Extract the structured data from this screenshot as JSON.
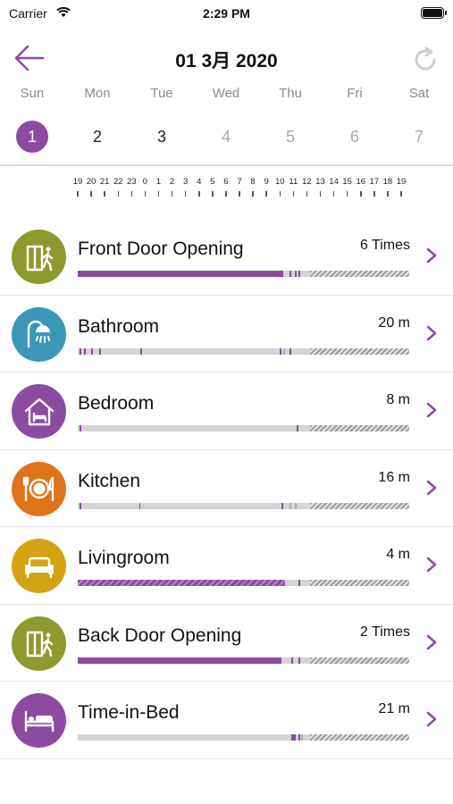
{
  "status_bar": {
    "carrier": "Carrier",
    "time": "2:29 PM"
  },
  "header": {
    "title": "01 3月 2020",
    "back_icon": "arrow-left-icon",
    "refresh_icon": "refresh-icon"
  },
  "colors": {
    "accent": "#8b4b9f",
    "olive": "#8e9a2f",
    "teal": "#3b97b5",
    "orange": "#e0731a",
    "mustard": "#d2a313",
    "purple": "#8b4b9f",
    "bar_bg": "#d4d4d4"
  },
  "weekdays": [
    "Sun",
    "Mon",
    "Tue",
    "Wed",
    "Thu",
    "Fri",
    "Sat"
  ],
  "days": [
    {
      "label": "1",
      "state": "selected"
    },
    {
      "label": "2",
      "state": "past"
    },
    {
      "label": "3",
      "state": "past"
    },
    {
      "label": "4",
      "state": "future"
    },
    {
      "label": "5",
      "state": "future"
    },
    {
      "label": "6",
      "state": "future"
    },
    {
      "label": "7",
      "state": "future"
    }
  ],
  "hour_labels": [
    "19",
    "20",
    "21",
    "22",
    "23",
    "0",
    "1",
    "2",
    "3",
    "4",
    "5",
    "6",
    "7",
    "8",
    "9",
    "10",
    "11",
    "12",
    "13",
    "14",
    "15",
    "16",
    "17",
    "18",
    "19"
  ],
  "rooms": [
    {
      "label": "Front Door Opening",
      "value": "6 Times",
      "icon": "door-walk-icon",
      "color": "#8e9a2f",
      "activity": [
        [
          0.0,
          0.62,
          "solid"
        ],
        [
          0.64,
          0.005,
          "solid"
        ],
        [
          0.655,
          0.004,
          "solid"
        ],
        [
          0.665,
          0.004,
          "solid"
        ]
      ],
      "now": 0.7
    },
    {
      "label": "Bathroom",
      "value": "20 m",
      "icon": "shower-icon",
      "color": "#3b97b5",
      "activity": [
        [
          0.005,
          0.004,
          "solid"
        ],
        [
          0.02,
          0.004,
          "solid"
        ],
        [
          0.04,
          0.004,
          "solid"
        ],
        [
          0.065,
          0.004,
          "solid"
        ],
        [
          0.19,
          0.004,
          "solid"
        ],
        [
          0.61,
          0.004,
          "solid"
        ],
        [
          0.62,
          0.004,
          "light"
        ],
        [
          0.64,
          0.004,
          "solid"
        ]
      ],
      "now": 0.7
    },
    {
      "label": "Bedroom",
      "value": "8 m",
      "icon": "house-bed-icon",
      "color": "#8b4b9f",
      "activity": [
        [
          0.005,
          0.004,
          "solid"
        ],
        [
          0.66,
          0.004,
          "solid"
        ]
      ],
      "now": 0.7
    },
    {
      "label": "Kitchen",
      "value": "16 m",
      "icon": "plate-cutlery-icon",
      "color": "#e0731a",
      "activity": [
        [
          0.005,
          0.004,
          "solid"
        ],
        [
          0.185,
          0.004,
          "solid"
        ],
        [
          0.615,
          0.004,
          "solid"
        ],
        [
          0.64,
          0.004,
          "light"
        ],
        [
          0.655,
          0.004,
          "light"
        ]
      ],
      "now": 0.7
    },
    {
      "label": "Livingroom",
      "value": "4 m",
      "icon": "sofa-icon",
      "color": "#d2a313",
      "activity": [
        [
          0.0,
          0.625,
          "striped"
        ],
        [
          0.665,
          0.004,
          "solid"
        ]
      ],
      "now": 0.7
    },
    {
      "label": "Back Door Opening",
      "value": "2 Times",
      "icon": "door-walk-icon",
      "color": "#8e9a2f",
      "activity": [
        [
          0.0,
          0.615,
          "solid"
        ],
        [
          0.645,
          0.004,
          "solid"
        ],
        [
          0.665,
          0.004,
          "solid"
        ]
      ],
      "now": 0.7
    },
    {
      "label": "Time-in-Bed",
      "value": "21 m",
      "icon": "bed-icon",
      "color": "#8b4b9f",
      "activity": [
        [
          0.645,
          0.012,
          "solid"
        ],
        [
          0.665,
          0.004,
          "solid"
        ],
        [
          0.675,
          0.004,
          "light"
        ]
      ],
      "now": 0.7
    }
  ]
}
